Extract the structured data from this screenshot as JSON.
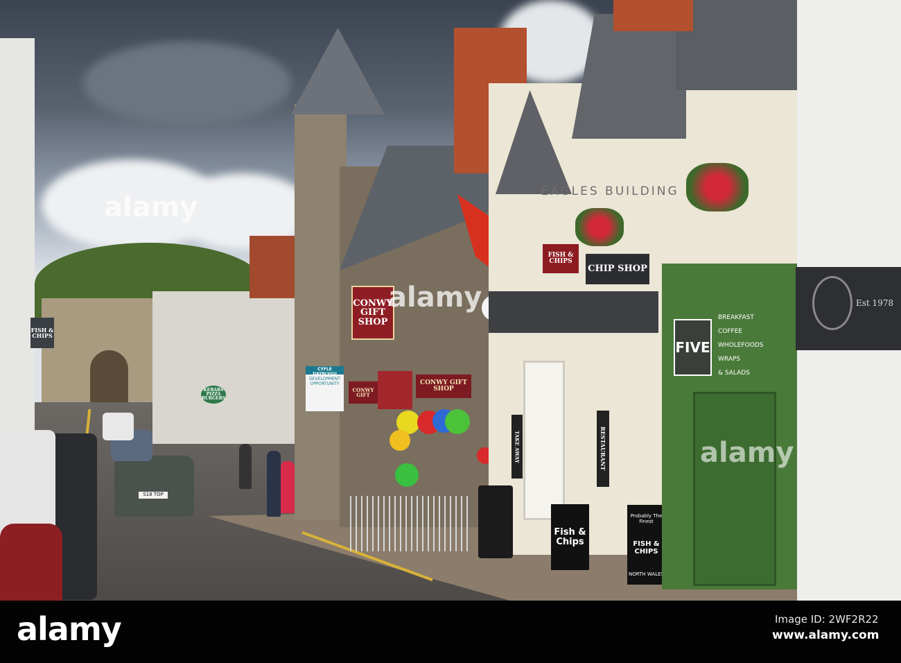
{
  "watermark": {
    "logo": "alamy",
    "center": "alamy"
  },
  "footer": {
    "image_id": "Image ID: 2WF2R22",
    "url": "www.alamy.com"
  },
  "signs": {
    "gift_shop_hanging": "CONWY GIFT SHOP",
    "gift_shop_fascia": "CONWY GIFT SHOP",
    "gift_shop_small": "CONWY GIFT",
    "fish_chips_hanging": "FISH & CHIPS",
    "chip_shop": "CHIP SHOP",
    "building_name": "EAGLES BUILDING",
    "five": "FIVE",
    "five_menu": [
      "BREAKFAST",
      "COFFEE",
      "WHOLEFOODS",
      "WRAPS",
      "& SALADS"
    ],
    "est": "Est 1978",
    "take_away": "TAKE AWAY",
    "restaurant": "RESTAURANT",
    "board_fish_chips": "Fish & Chips",
    "board_finest_top": "Probably The Finest",
    "board_finest_main": "FISH & CHIPS",
    "board_finest_bottom": "NORTH WALES",
    "cyfle": "CYFLE DATBLYGU",
    "cyfle_sub": "DEVELOPMENT OPPORTUNITY",
    "left_fish": "FISH & CHIPS",
    "kebabs": "KEBABS PIZZA BURGERS",
    "plate": "S18 TOP"
  }
}
